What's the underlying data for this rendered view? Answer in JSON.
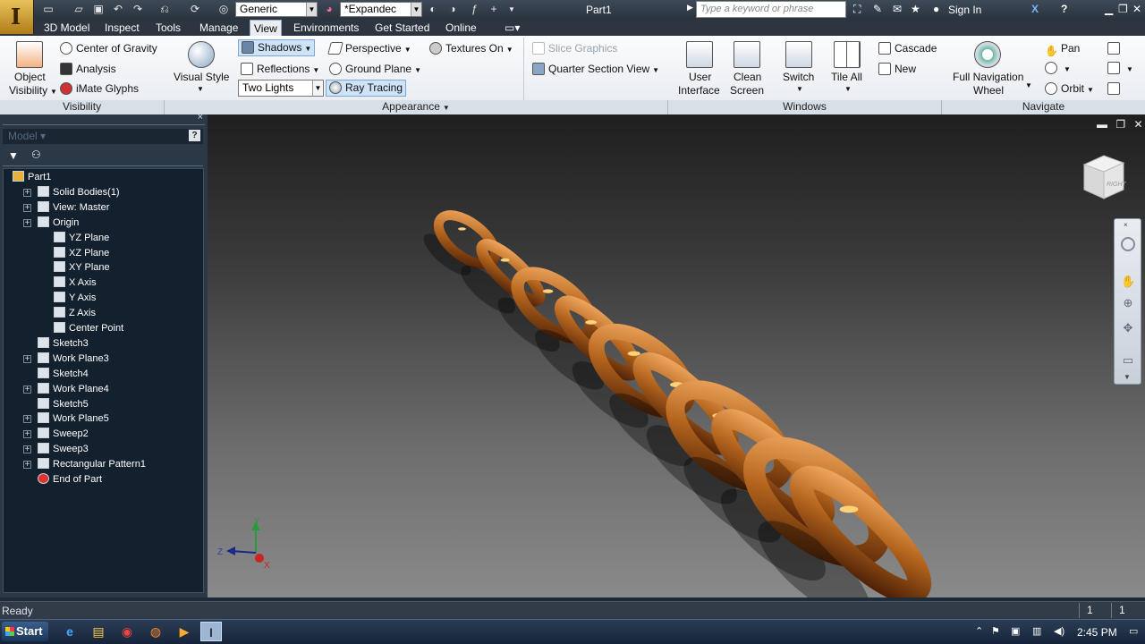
{
  "titlebar": {
    "app_letter": "I",
    "material_combo": "Generic",
    "appearance_combo": "*Expandec",
    "document_title": "Part1",
    "search_placeholder": "Type a keyword or phrase",
    "sign_in": "Sign In"
  },
  "tabs": [
    {
      "label": "3D Model"
    },
    {
      "label": "Inspect"
    },
    {
      "label": "Tools"
    },
    {
      "label": "Manage"
    },
    {
      "label": "View",
      "active": true
    },
    {
      "label": "Environments"
    },
    {
      "label": "Get Started"
    },
    {
      "label": "Online"
    }
  ],
  "ribbon": {
    "visibility": {
      "object_visibility_1": "Object",
      "object_visibility_2": "Visibility",
      "center_of_gravity": "Center of Gravity",
      "analysis": "Analysis",
      "imate_glyphs": "iMate Glyphs",
      "label": "Visibility"
    },
    "appearance": {
      "visual_style": "Visual Style",
      "shadows": "Shadows",
      "reflections": "Reflections",
      "lighting": "Two Lights",
      "perspective": "Perspective",
      "ground_plane": "Ground Plane",
      "ray_tracing": "Ray Tracing",
      "textures_on": "Textures On",
      "slice_graphics": "Slice Graphics",
      "quarter_section_view": "Quarter Section View",
      "label": "Appearance"
    },
    "windows": {
      "user_interface_1": "User",
      "user_interface_2": "Interface",
      "clean_screen_1": "Clean",
      "clean_screen_2": "Screen",
      "switch": "Switch",
      "tile_all": "Tile All",
      "cascade": "Cascade",
      "new": "New",
      "label": "Windows"
    },
    "navigate": {
      "full_nav_1": "Full Navigation",
      "full_nav_2": "Wheel",
      "pan": "Pan",
      "orbit": "Orbit",
      "label": "Navigate"
    }
  },
  "browser": {
    "model_label": "Model",
    "tree": [
      {
        "label": "Part1",
        "level": 0,
        "expander": false
      },
      {
        "label": "Solid Bodies(1)",
        "level": 1,
        "expander": true
      },
      {
        "label": "View: Master",
        "level": 1,
        "expander": true
      },
      {
        "label": "Origin",
        "level": 1,
        "expander": true
      },
      {
        "label": "YZ Plane",
        "level": 2,
        "expander": false
      },
      {
        "label": "XZ Plane",
        "level": 2,
        "expander": false
      },
      {
        "label": "XY Plane",
        "level": 2,
        "expander": false
      },
      {
        "label": "X Axis",
        "level": 2,
        "expander": false
      },
      {
        "label": "Y Axis",
        "level": 2,
        "expander": false
      },
      {
        "label": "Z Axis",
        "level": 2,
        "expander": false
      },
      {
        "label": "Center Point",
        "level": 2,
        "expander": false
      },
      {
        "label": "Sketch3",
        "level": 1,
        "expander": false
      },
      {
        "label": "Work Plane3",
        "level": 1,
        "expander": true
      },
      {
        "label": "Sketch4",
        "level": 1,
        "expander": false
      },
      {
        "label": "Work Plane4",
        "level": 1,
        "expander": true
      },
      {
        "label": "Sketch5",
        "level": 1,
        "expander": false
      },
      {
        "label": "Work Plane5",
        "level": 1,
        "expander": true
      },
      {
        "label": "Sweep2",
        "level": 1,
        "expander": true
      },
      {
        "label": "Sweep3",
        "level": 1,
        "expander": true
      },
      {
        "label": "Rectangular Pattern1",
        "level": 1,
        "expander": true
      },
      {
        "label": "End of Part",
        "level": 1,
        "expander": false
      }
    ]
  },
  "viewport": {
    "viewcube_face": "RIGHT",
    "axis_x": "X",
    "axis_y": "Y",
    "axis_z": "Z",
    "chain_color": "#b5651d"
  },
  "status": {
    "text": "Ready",
    "cell1": "1",
    "cell2": "1"
  },
  "taskbar": {
    "start": "Start",
    "clock": "2:45 PM"
  }
}
